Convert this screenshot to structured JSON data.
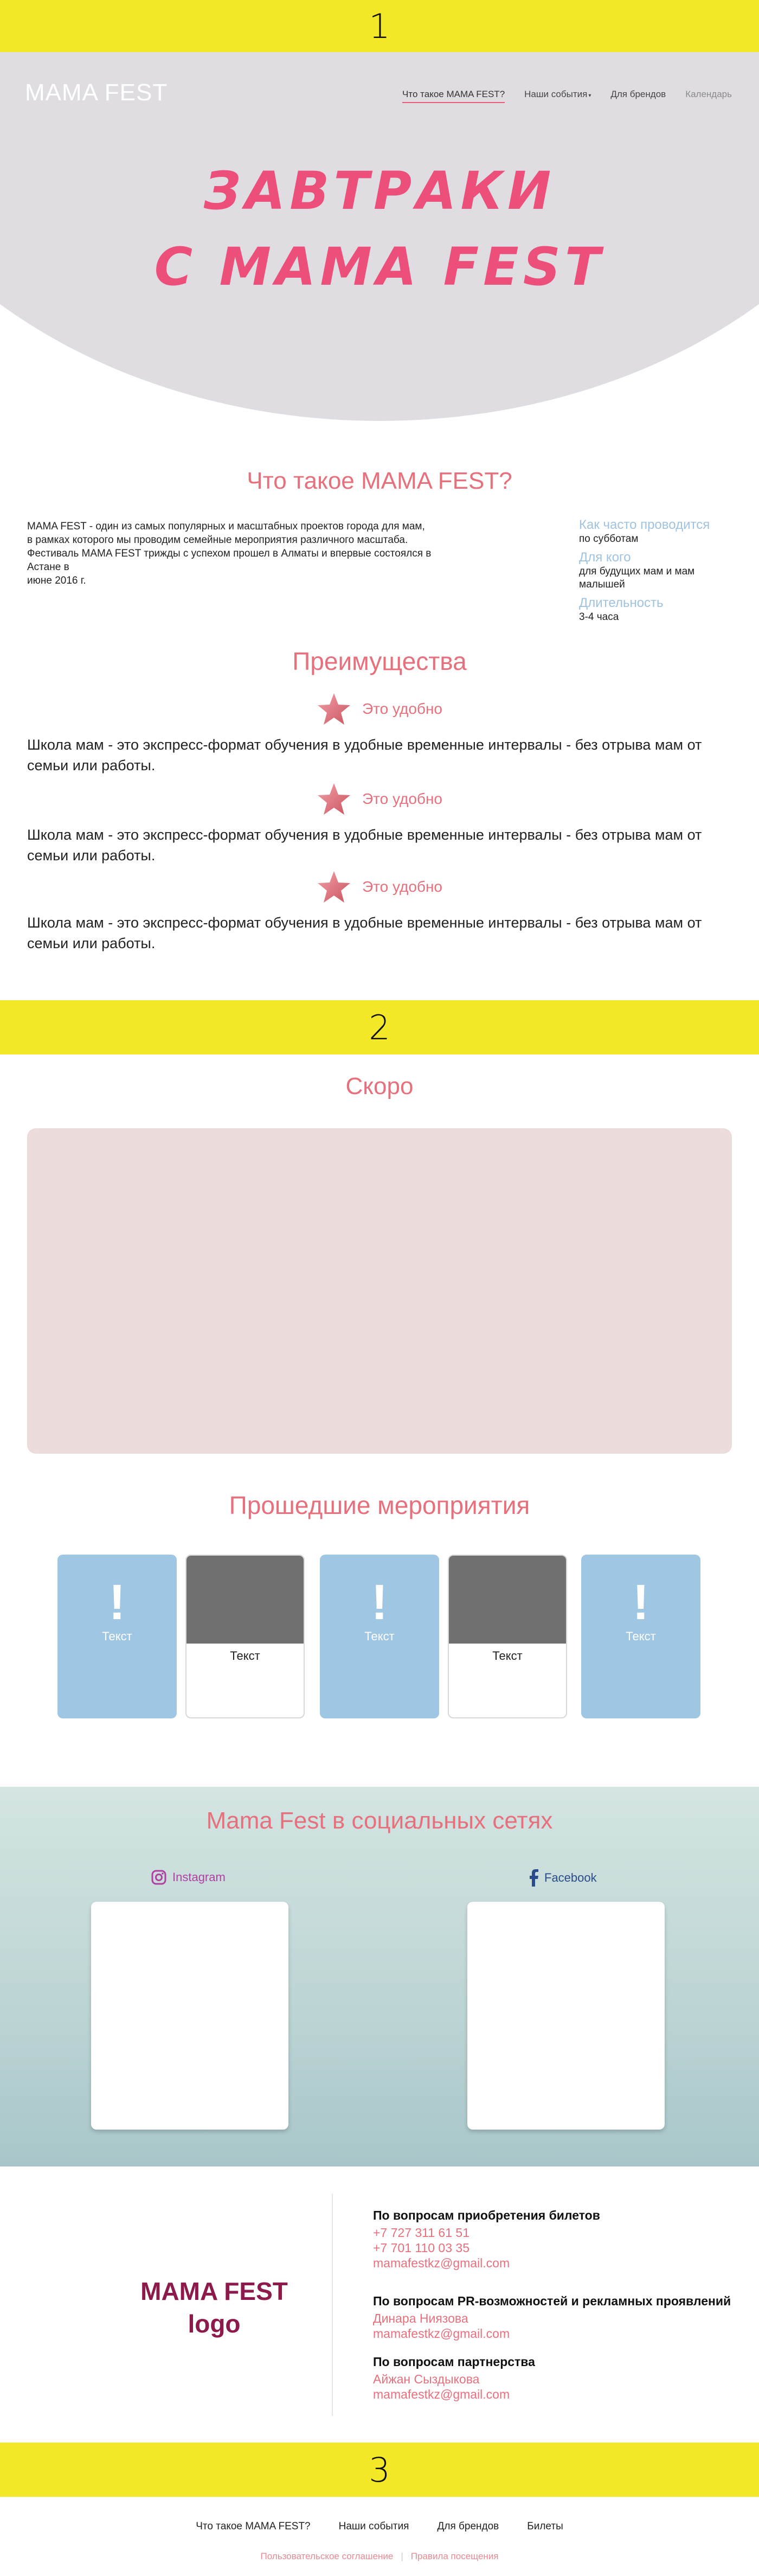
{
  "bands": {
    "b1": "1",
    "b2": "2",
    "b3": "3"
  },
  "header": {
    "logo": "MAMA FEST",
    "nav": [
      "Что такое MAMA FEST?",
      "Наши события",
      "Для брендов",
      "Календарь"
    ],
    "nav_events_caret": "▾"
  },
  "hero": {
    "line1": "ЗАВТРАКИ",
    "line2": "С MAMA FEST"
  },
  "about": {
    "title": "Что такое MAMA FEST?",
    "desc_lines": [
      "MAMA FEST - один из самых популярных и масштабных проектов города для мам,",
      "в рамках которого мы проводим семейные мероприятия различного масштаба.",
      "Фестиваль MAMA FEST трижды с успехом прошел в Алматы и впервые состоялся в",
      "Астане в",
      "июне 2016 г."
    ],
    "side": [
      {
        "q": "Как часто проводится",
        "a": "по субботам"
      },
      {
        "q": "Для кого",
        "a": "для будущих мам и мам малышей"
      },
      {
        "q": "Длительность",
        "a": "3-4 часа"
      }
    ]
  },
  "advantages": {
    "title": "Преимущества",
    "items": [
      {
        "head": "Это удобно",
        "body": "Школа мам - это экспресс-формат обучения в удобные временные интервалы - без отрыва мам от семьи или работы."
      },
      {
        "head": "Это удобно",
        "body": "Школа мам - это экспресс-формат обучения в удобные временные интервалы - без отрыва мам от семьи или работы."
      },
      {
        "head": "Это удобно",
        "body": "Школа мам - это экспресс-формат обучения в удобные временные интервалы - без отрыва мам от семьи или работы."
      }
    ]
  },
  "soon": {
    "title": "Скоро"
  },
  "past": {
    "title": "Прошедшие мероприятия",
    "cards": [
      {
        "type": "blue",
        "icon": "!",
        "text": "Текст"
      },
      {
        "type": "gray",
        "text": "Текст"
      },
      {
        "type": "blue",
        "icon": "!",
        "text": "Текст"
      },
      {
        "type": "gray",
        "text": "Текст"
      },
      {
        "type": "blue",
        "icon": "!",
        "text": "Текст"
      }
    ]
  },
  "social": {
    "title": "Mama Fest в социальных сетях",
    "instagram": "Instagram",
    "facebook": "Facebook",
    "instagram_color": "#b03fa2",
    "facebook_color": "#2b4c8a"
  },
  "contacts": {
    "logo_line1": "MAMA FEST",
    "logo_line2": "logo",
    "groups": [
      {
        "heading": "По вопросам приобретения билетов",
        "lines": [
          "+7 727 311 61 51",
          "+7 701 110 03 35",
          "mamafestkz@gmail.com"
        ]
      },
      {
        "heading": "По вопросам PR-возможностей и рекламных проявлений",
        "lines": [
          "Динара Ниязова",
          "mamafestkz@gmail.com"
        ]
      },
      {
        "heading": "По вопросам партнерства",
        "lines": [
          "Айжан Сыздыкова",
          "mamafestkz@gmail.com"
        ]
      }
    ]
  },
  "footer": {
    "nav": [
      "Что такое MAMA FEST?",
      "Наши события",
      "Для брендов",
      "Билеты"
    ],
    "legal": [
      "Пользовательское соглашение",
      "Правила посещения"
    ],
    "separator": "|"
  },
  "colors": {
    "accent": "#e7707d",
    "yellow": "#f3e928",
    "hero_bg": "#e0dde2",
    "soon_bg": "#ecdcdb",
    "card_blue": "#9fc6e2",
    "logo": "#8c1a4a"
  }
}
